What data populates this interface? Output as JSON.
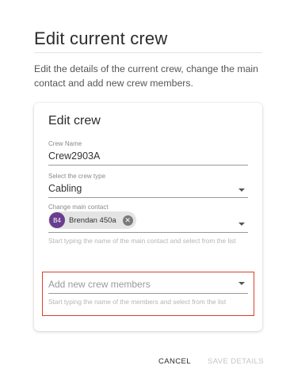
{
  "page": {
    "title": "Edit current crew",
    "description": "Edit the details of the current crew, change the main contact and add new crew members."
  },
  "card": {
    "title": "Edit crew",
    "crew_name": {
      "label": "Crew Name",
      "value": "Crew2903A"
    },
    "crew_type": {
      "label": "Select the crew type",
      "value": "Cabling"
    },
    "main_contact": {
      "label": "Change main contact",
      "chip": {
        "initials": "B4",
        "name": "Brendan 450a",
        "avatar_color": "#6a3d8f"
      },
      "helper": "Start typing the name of the main contact and select from the list"
    },
    "new_members": {
      "placeholder": "Add new crew members",
      "helper": "Start typing the name of the members and select from the list"
    }
  },
  "actions": {
    "cancel_label": "CANCEL",
    "save_label": "SAVE DETAILS"
  },
  "colors": {
    "highlight": "#d9402b",
    "chip_avatar": "#6a3d8f"
  }
}
